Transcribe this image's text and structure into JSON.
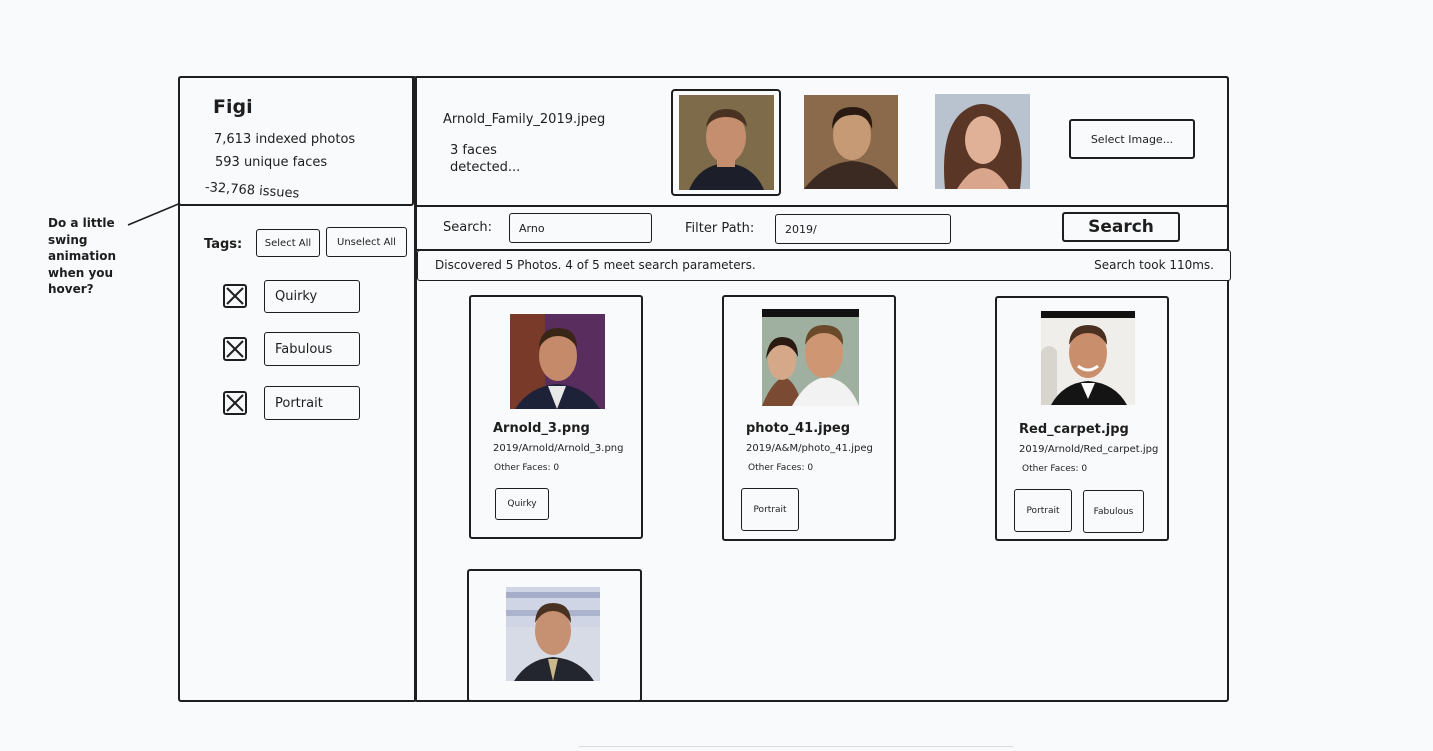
{
  "note": {
    "line1": "Do a little",
    "line2": "swing",
    "line3": "animation",
    "line4": "when you",
    "line5": "hover?"
  },
  "sidebar": {
    "app_name": "Figi",
    "stats": {
      "photos": "7,613 indexed photos",
      "faces": "593 unique faces",
      "issues": "-32,768 issues"
    },
    "tags_label": "Tags:",
    "select_all": "Select All",
    "unselect_all": "Unselect All",
    "tags": [
      {
        "label": "Quirky",
        "checked": true
      },
      {
        "label": "Fabulous",
        "checked": true
      },
      {
        "label": "Portrait",
        "checked": true
      }
    ]
  },
  "query": {
    "filename": "Arnold_Family_2019.jpeg",
    "faces_line1": "3 faces",
    "faces_line2": "detected...",
    "select_image": "Select Image...",
    "face_icons": [
      "face-arnold-icon",
      "face-man-icon",
      "face-woman-icon"
    ]
  },
  "search": {
    "search_label": "Search:",
    "search_value": "Arno",
    "filter_label": "Filter Path:",
    "filter_value": "2019/",
    "button": "Search"
  },
  "status": {
    "summary": "Discovered 5 Photos. 4 of 5 meet search parameters.",
    "time": "Search took 110ms."
  },
  "results": [
    {
      "name": "Arnold_3.png",
      "path": "2019/Arnold/Arnold_3.png",
      "other_faces": "Other Faces: 0",
      "tags": [
        "Quirky"
      ]
    },
    {
      "name": "photo_41.jpeg",
      "path": "2019/A&M/photo_41.jpeg",
      "other_faces": "Other Faces: 0",
      "tags": [
        "Portrait"
      ]
    },
    {
      "name": "Red_carpet.jpg",
      "path": "2019/Arnold/Red_carpet.jpg",
      "other_faces": "Other Faces: 0",
      "tags": [
        "Portrait",
        "Fabulous"
      ]
    },
    {
      "name": "",
      "path": "",
      "other_faces": "",
      "tags": []
    }
  ],
  "colors": {
    "ink": "#1e1e1e",
    "background": "#f9fafb"
  }
}
